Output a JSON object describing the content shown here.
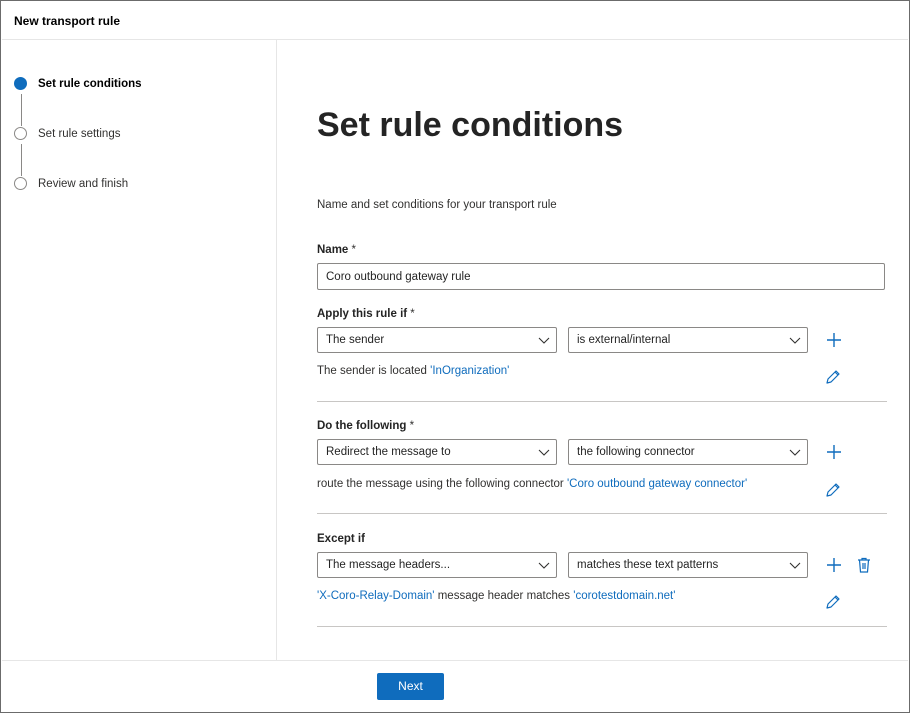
{
  "window": {
    "title": "New transport rule"
  },
  "wizard": {
    "steps": [
      {
        "label": "Set rule conditions",
        "state": "active"
      },
      {
        "label": "Set rule settings",
        "state": "pending"
      },
      {
        "label": "Review and finish",
        "state": "pending"
      }
    ]
  },
  "page": {
    "heading": "Set rule conditions",
    "description": "Name and set conditions for your transport rule"
  },
  "name_field": {
    "label": "Name",
    "required_mark": "*",
    "value": "Coro outbound gateway rule"
  },
  "apply_section": {
    "label": "Apply this rule if",
    "required_mark": "*",
    "condition": "The sender",
    "operator": "is external/internal",
    "summary_prefix": "The sender is located",
    "summary_value": "'InOrganization'"
  },
  "action_section": {
    "label": "Do the following",
    "required_mark": "*",
    "action": "Redirect the message to",
    "target": "the following connector",
    "summary_prefix": "route the message using the following connector",
    "summary_value": "'Coro outbound gateway connector'"
  },
  "except_section": {
    "label": "Except if",
    "condition": "The message headers...",
    "operator": "matches these text patterns",
    "header_name": "'X-Coro-Relay-Domain'",
    "summary_middle": "message header matches",
    "summary_value": "'corotestdomain.net'"
  },
  "footer": {
    "next_label": "Next"
  },
  "colors": {
    "accent": "#0f6cbd",
    "text": "#323130",
    "border": "#8a8886"
  },
  "icons": [
    "add-icon",
    "edit-icon",
    "delete-icon",
    "chevron-down-icon"
  ]
}
